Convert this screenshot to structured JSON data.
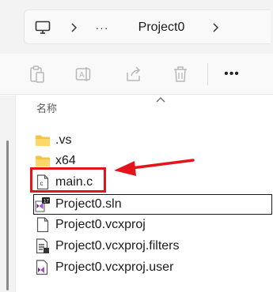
{
  "address_bar": {
    "breadcrumb": "Project0",
    "more_label": "···"
  },
  "toolbar": {
    "more_label": "•••"
  },
  "list": {
    "column_header": "名称",
    "items": [
      {
        "name": ".vs",
        "icon": "folder-icon"
      },
      {
        "name": "x64",
        "icon": "folder-icon"
      },
      {
        "name": "main.c",
        "icon": "c-source-file-icon"
      },
      {
        "name": "Project0.sln",
        "icon": "visual-studio-solution-icon"
      },
      {
        "name": "Project0.vcxproj",
        "icon": "blank-file-icon"
      },
      {
        "name": "Project0.vcxproj.filters",
        "icon": "filters-file-icon"
      },
      {
        "name": "Project0.vcxproj.user",
        "icon": "vs-user-file-icon"
      }
    ]
  },
  "annotation": {
    "highlight_color": "#e3141c",
    "target": "main.c"
  },
  "colors": {
    "folder": "#f5c242",
    "vs_purple": "#68217a",
    "accent_red": "#e3141c"
  }
}
